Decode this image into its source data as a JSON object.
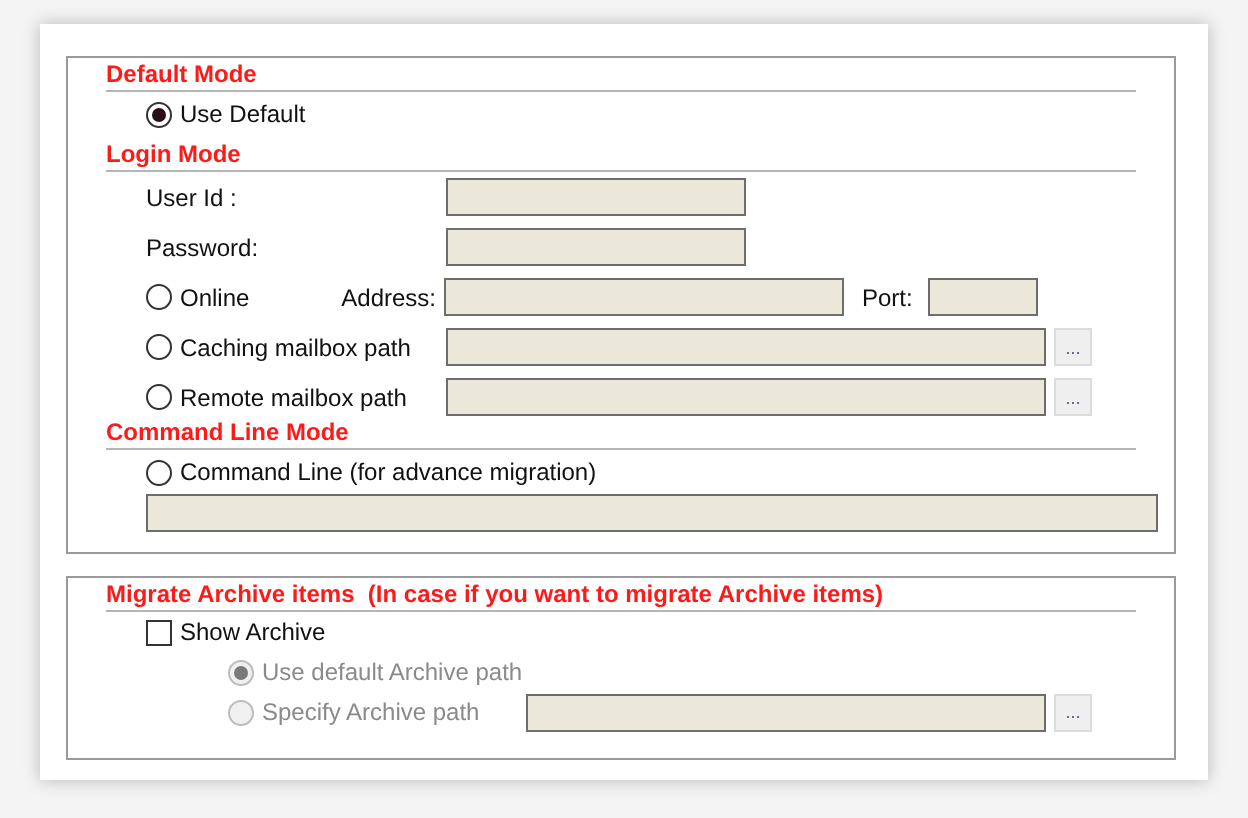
{
  "default_mode": {
    "title": "Default Mode",
    "use_default": {
      "label": "Use Default",
      "selected": true
    }
  },
  "login_mode": {
    "title": "Login Mode",
    "user_id": {
      "label": "User Id :"
    },
    "password": {
      "label": "Password:"
    },
    "online": {
      "label": "Online",
      "selected": false
    },
    "address": {
      "label": "Address:"
    },
    "port": {
      "label": "Port:"
    },
    "caching": {
      "label": "Caching mailbox path",
      "selected": false,
      "browse": "..."
    },
    "remote": {
      "label": "Remote mailbox path",
      "selected": false,
      "browse": "..."
    }
  },
  "command_line_mode": {
    "title": "Command Line Mode",
    "command_line": {
      "label": "Command Line (for advance migration)",
      "selected": false
    }
  },
  "archive": {
    "title": "Migrate Archive items  (In case if you want to migrate Archive items)",
    "show_archive": {
      "label": "Show Archive",
      "checked": false
    },
    "options": [
      {
        "label": "Use default Archive path",
        "selected": true,
        "disabled": true
      },
      {
        "label": "Specify Archive path",
        "selected": false,
        "disabled": true,
        "browse": "..."
      }
    ]
  }
}
